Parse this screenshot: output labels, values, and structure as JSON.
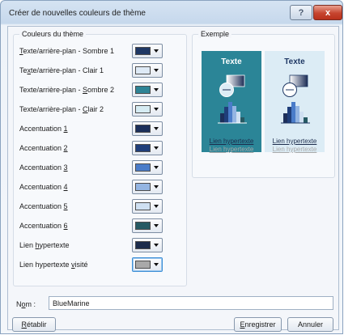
{
  "dialog": {
    "title": "Créer de nouvelles couleurs de thème",
    "help_symbol": "?",
    "close_symbol": "x"
  },
  "colors_group": {
    "title": "Couleurs du thème",
    "rows": [
      {
        "pre": "",
        "u": "T",
        "post": "exte/arrière-plan - Sombre 1",
        "color": "#1f3864"
      },
      {
        "pre": "Te",
        "u": "x",
        "post": "te/arrière-plan - Clair 1",
        "color": "#deeaf6"
      },
      {
        "pre": "Texte/arrière-plan - ",
        "u": "S",
        "post": "ombre 2",
        "color": "#2e8496"
      },
      {
        "pre": "Texte/arrière-plan - ",
        "u": "C",
        "post": "lair 2",
        "color": "#d6ecf3"
      },
      {
        "pre": "Accentuation ",
        "u": "1",
        "post": "",
        "color": "#1c2f5a"
      },
      {
        "pre": "Accentuation ",
        "u": "2",
        "post": "",
        "color": "#1f3e7a"
      },
      {
        "pre": "Accentuation ",
        "u": "3",
        "post": "",
        "color": "#4a7cc9"
      },
      {
        "pre": "Accentuation ",
        "u": "4",
        "post": "",
        "color": "#94b5e2"
      },
      {
        "pre": "Accentuation ",
        "u": "5",
        "post": "",
        "color": "#cfe0f2"
      },
      {
        "pre": "Accentuation ",
        "u": "6",
        "post": "",
        "color": "#265a63"
      },
      {
        "pre": "Lien ",
        "u": "h",
        "post": "ypertexte",
        "color": "#1c2c4c"
      },
      {
        "pre": "Lien hypertexte ",
        "u": "v",
        "post": "isité",
        "color": "#a9a9a9"
      }
    ]
  },
  "sample_group": {
    "title": "Exemple",
    "dark": {
      "text": "Texte",
      "link": "Lien hypertexte",
      "visited": "Lien hypertexte",
      "bg": "#2b8597"
    },
    "light": {
      "text": "Texte",
      "link": "Lien hypertexte",
      "visited": "Lien hypertexte",
      "bg": "#dcecf5"
    }
  },
  "name_field": {
    "label_pre": "N",
    "label_u": "o",
    "label_post": "m :",
    "value": "BlueMarine"
  },
  "buttons": {
    "reset": {
      "u": "R",
      "post": "établir"
    },
    "save": {
      "u": "E",
      "post": "nregistrer"
    },
    "cancel": {
      "label": "Annuler"
    }
  }
}
